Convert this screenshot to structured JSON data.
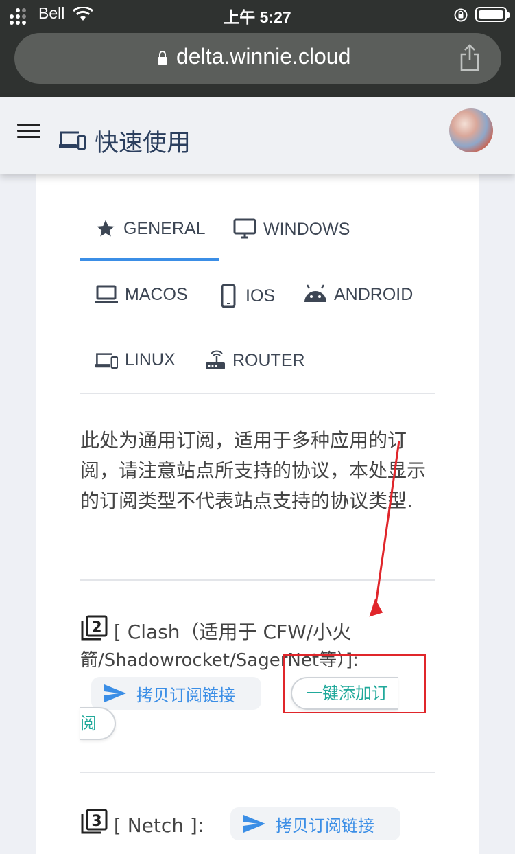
{
  "status_bar": {
    "carrier": "Bell",
    "time": "上午 5:27"
  },
  "browser": {
    "url": "delta.winnie.cloud"
  },
  "header": {
    "title": "快速使用"
  },
  "tabs": [
    {
      "label": "GENERAL",
      "icon": "star-icon",
      "active": true
    },
    {
      "label": "WINDOWS",
      "icon": "monitor-icon",
      "active": false
    },
    {
      "label": "MACOS",
      "icon": "laptop-icon",
      "active": false
    },
    {
      "label": "IOS",
      "icon": "phone-icon",
      "active": false
    },
    {
      "label": "ANDROID",
      "icon": "android-icon",
      "active": false
    },
    {
      "label": "LINUX",
      "icon": "devices-icon",
      "active": false
    },
    {
      "label": "ROUTER",
      "icon": "router-icon",
      "active": false
    }
  ],
  "content": {
    "description": "此处为通用订阅，适用于多种应用的订阅，请注意站点所支持的协议，本处显示的订阅类型不代表站点支持的协议类型.",
    "subscriptions": [
      {
        "number": "2",
        "label_line1": "[ Clash（适用于 CFW/小火",
        "label_line2": "箭/Shadowrocket/SagerNet等）]:",
        "copy_button": "拷贝订阅链接",
        "add_button_part1": "一键添加订",
        "add_button_part2": "阅"
      },
      {
        "number": "3",
        "label": "[ Netch ]:",
        "copy_button": "拷贝订阅链接"
      }
    ]
  },
  "colors": {
    "accent": "#3b8ee6",
    "add_button_text": "#21a99b",
    "annotation_red": "#e0262b"
  }
}
